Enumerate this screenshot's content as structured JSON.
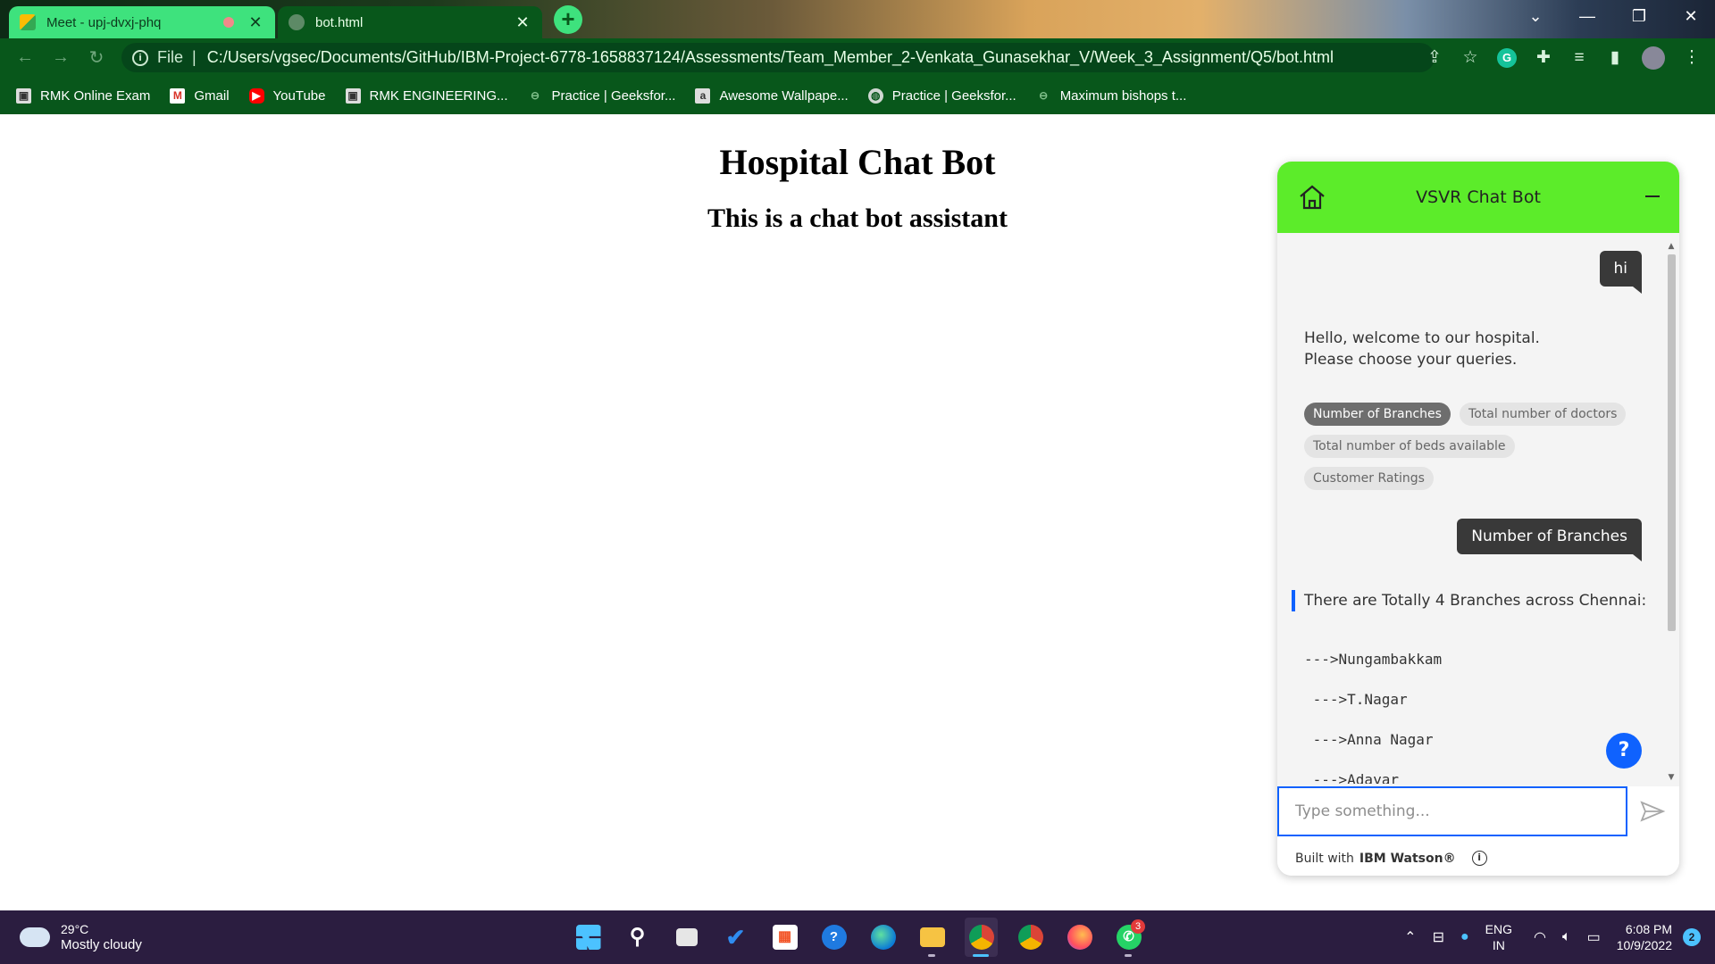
{
  "browser": {
    "tabs": [
      {
        "title": "Meet - upj-dvxj-phq",
        "active": false
      },
      {
        "title": "bot.html",
        "active": true
      }
    ],
    "new_tab_label": "+",
    "window_controls": {
      "tabs_search": "⌄",
      "minimize": "—",
      "restore": "❐",
      "close": "✕"
    },
    "scheme_label": "File",
    "url": "C:/Users/vgsec/Documents/GitHub/IBM-Project-6778-1658837124/Assessments/Team_Member_2-Venkata_Gunasekhar_V/Week_3_Assignment/Q5/bot.html",
    "bookmarks": [
      {
        "label": "RMK Online Exam",
        "icon": "rmk-icon"
      },
      {
        "label": "Gmail",
        "icon": "gmail-icon"
      },
      {
        "label": "YouTube",
        "icon": "youtube-icon"
      },
      {
        "label": "RMK ENGINEERING...",
        "icon": "rmk-engg-icon"
      },
      {
        "label": "Practice | Geeksfor...",
        "icon": "geeksforgeeks-icon"
      },
      {
        "label": "Awesome Wallpape...",
        "icon": "wallpaper-icon"
      },
      {
        "label": "Practice | Geeksfor...",
        "icon": "globe-icon"
      },
      {
        "label": "Maximum bishops t...",
        "icon": "geeksforgeeks-icon"
      }
    ]
  },
  "page": {
    "heading": "Hospital Chat Bot",
    "subheading": "This is a chat bot assistant"
  },
  "chat": {
    "header_title": "VSVR Chat Bot",
    "user_message_1": "hi",
    "bot_greeting_line1": "Hello, welcome to our hospital.",
    "bot_greeting_line2": "Please choose your queries.",
    "options": [
      {
        "label": "Number of Branches",
        "selected": true
      },
      {
        "label": "Total number of doctors",
        "selected": false
      },
      {
        "label": "Total number of beds available",
        "selected": false
      },
      {
        "label": "Customer Ratings",
        "selected": false
      }
    ],
    "user_message_2": "Number of Branches",
    "bot_response": "There are Totally 4 Branches across Chennai:",
    "branches": [
      "--->Nungambakkam",
      " --->T.Nagar",
      " --->Anna Nagar",
      " --->Adayar"
    ],
    "help_label": "?",
    "input_placeholder": "Type something...",
    "input_value": "",
    "built_with_prefix": "Built with",
    "built_with_brand": "IBM Watson®",
    "accent_color": "#5cec2a",
    "focus_color": "#0f62fe"
  },
  "taskbar": {
    "temperature": "29°C",
    "weather": "Mostly cloudy",
    "language_line1": "ENG",
    "language_line2": "IN",
    "time": "6:08 PM",
    "date": "10/9/2022",
    "notification_count": "2",
    "whatsapp_badge": "3"
  }
}
